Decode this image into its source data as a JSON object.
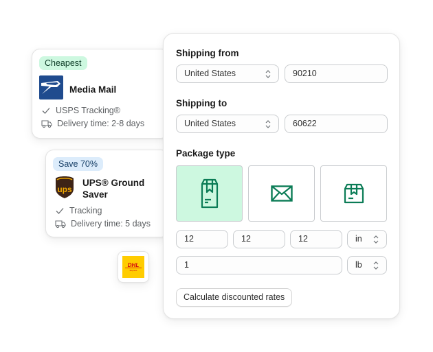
{
  "rates": [
    {
      "badge": "Cheapest",
      "carrier_icon": "usps-logo",
      "service": "Media Mail",
      "features": [
        {
          "icon": "check-icon",
          "text": "USPS Tracking®"
        },
        {
          "icon": "truck-icon",
          "text": "Delivery time: 2-8 days"
        }
      ]
    },
    {
      "badge": "Save 70%",
      "carrier_icon": "ups-logo",
      "service_line1": "UPS® Ground",
      "service_line2": "Saver",
      "features": [
        {
          "icon": "check-icon",
          "text": "Tracking"
        },
        {
          "icon": "truck-icon",
          "text": "Delivery time: 5 days"
        }
      ]
    }
  ],
  "dhl": {
    "logo_text": "DHL",
    "sub_text": "Express"
  },
  "form": {
    "shipping_from": {
      "label": "Shipping from",
      "country": "United States",
      "zip": "90210"
    },
    "shipping_to": {
      "label": "Shipping to",
      "country": "United States",
      "zip": "60622"
    },
    "package_type": {
      "label": "Package type",
      "options": [
        {
          "name": "box-tall-icon",
          "selected": true
        },
        {
          "name": "envelope-icon",
          "selected": false
        },
        {
          "name": "box-icon",
          "selected": false
        }
      ]
    },
    "dimensions": {
      "length": "12",
      "width": "12",
      "height": "12",
      "unit": "in"
    },
    "weight": {
      "value": "1",
      "unit": "lb"
    },
    "calculate_label": "Calculate discounted rates"
  },
  "colors": {
    "accent_green": "#0b7c56",
    "selected_bg": "#cdf8e0",
    "cheapest_badge": "#cdf8e0",
    "save_badge": "#dcecfb"
  }
}
